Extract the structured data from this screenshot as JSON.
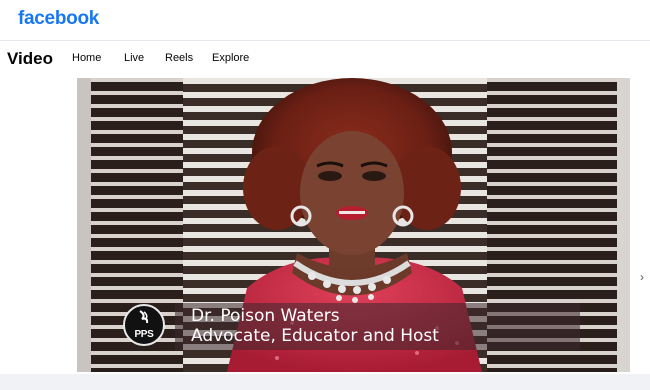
{
  "brand": {
    "logo_text": "facebook",
    "color": "#1877f2"
  },
  "nav": {
    "title": "Video",
    "items": [
      "Home",
      "Live",
      "Reels",
      "Explore"
    ]
  },
  "video": {
    "lower_third": {
      "name": "Dr. Poison Waters",
      "role": "Advocate, Educator and Host"
    },
    "badge_text": "PPS"
  },
  "icons": {
    "side_arrow": "chevron-right-icon"
  }
}
